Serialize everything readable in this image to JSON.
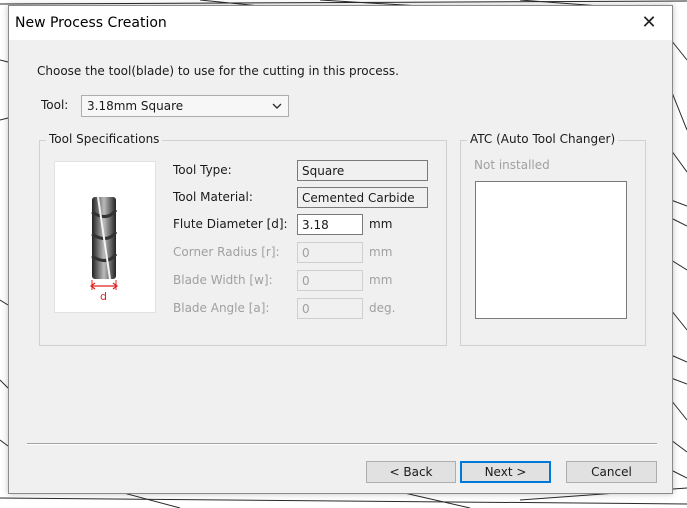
{
  "window": {
    "title": "New Process Creation",
    "close_glyph": "✕"
  },
  "instruction": "Choose the tool(blade) to use for the cutting in this process.",
  "tool_select": {
    "label": "Tool:",
    "value": "3.18mm Square"
  },
  "tool_specs": {
    "legend": "Tool Specifications",
    "image_label": "d",
    "rows": [
      {
        "label": "Tool Type:",
        "value": "Square",
        "unit": ""
      },
      {
        "label": "Tool Material:",
        "value": "Cemented Carbide",
        "unit": ""
      },
      {
        "label": "Flute Diameter [d]:",
        "value": "3.18",
        "unit": "mm"
      },
      {
        "label": "Corner Radius [r]:",
        "value": "0",
        "unit": "mm"
      },
      {
        "label": "Blade Width [w]:",
        "value": "0",
        "unit": "mm"
      },
      {
        "label": "Blade Angle [a]:",
        "value": "0",
        "unit": "deg."
      }
    ]
  },
  "atc": {
    "legend": "ATC (Auto Tool Changer)",
    "status": "Not installed"
  },
  "buttons": {
    "back": "< Back",
    "next": "Next >",
    "cancel": "Cancel"
  },
  "colors": {
    "accent": "#0078d7",
    "dimension_red": "#e02020"
  }
}
